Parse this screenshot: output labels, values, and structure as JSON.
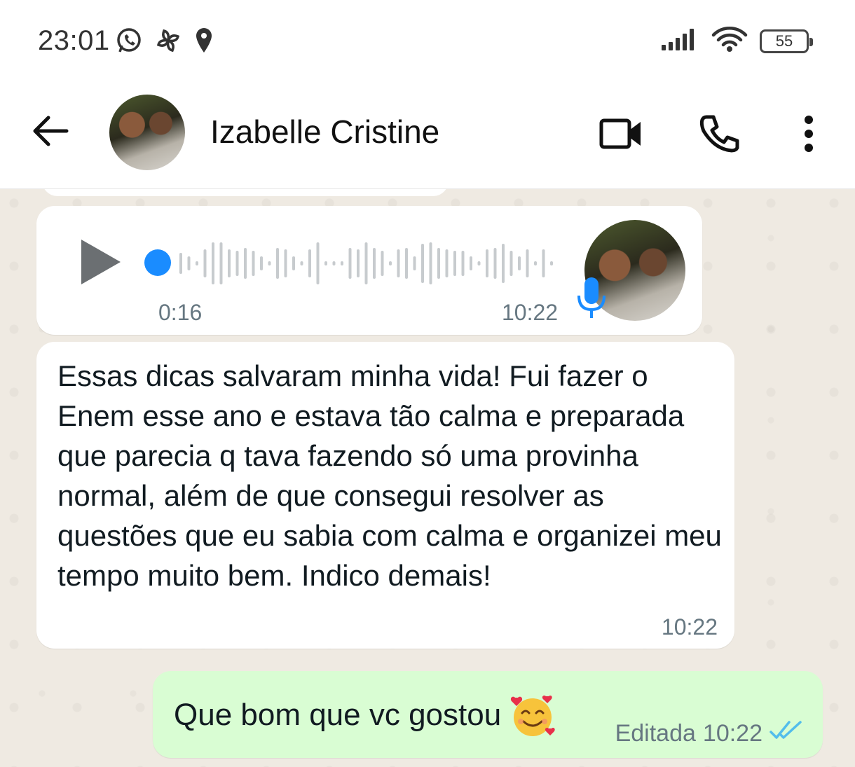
{
  "status_bar": {
    "time": "23:01",
    "icons_left": [
      "whatsapp-icon",
      "pinwheel-icon",
      "location-icon"
    ],
    "icons_right": [
      "signal-icon",
      "wifi-icon"
    ],
    "battery": "55"
  },
  "header": {
    "contact_name": "Izabelle Cristine",
    "icons": [
      "back-arrow-icon",
      "video-call-icon",
      "phone-icon",
      "more-options-icon"
    ]
  },
  "messages": [
    {
      "type": "voice",
      "direction": "incoming",
      "duration": "0:16",
      "time": "10:22",
      "progress": 0
    },
    {
      "type": "text",
      "direction": "incoming",
      "text": "Essas dicas salvaram minha vida! Fui fazer o Enem esse ano e estava tão calma e preparada que parecia q tava fazendo só uma provinha normal, além de que consegui resolver as questões que eu sabia com calma e organizei meu tempo muito bem. Indico demais!",
      "time": "10:22"
    },
    {
      "type": "text",
      "direction": "outgoing",
      "text": "Que bom que vc gostou",
      "emoji": "smiling-face-with-hearts",
      "edited_label": "Editada",
      "time": "10:22",
      "status": "read"
    }
  ],
  "colors": {
    "chat_background": "#efeae2",
    "incoming_bubble": "#ffffff",
    "outgoing_bubble": "#d9fdd3",
    "voice_accent": "#1a8cff",
    "read_ticks": "#53bdeb",
    "meta_text": "#667781"
  }
}
